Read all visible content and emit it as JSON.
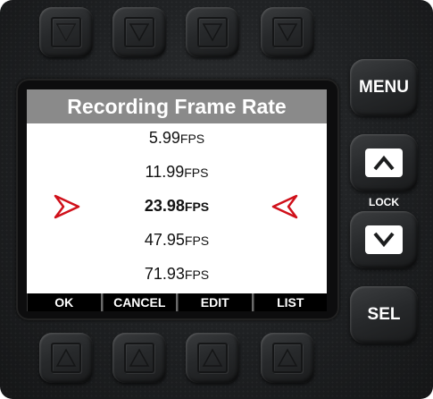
{
  "screen": {
    "title": "Recording Frame Rate",
    "fps_options": [
      {
        "value": "5.99",
        "unit": "FPS",
        "selected": false
      },
      {
        "value": "11.99",
        "unit": "FPS",
        "selected": false
      },
      {
        "value": "23.98",
        "unit": "FPS",
        "selected": true
      },
      {
        "value": "47.95",
        "unit": "FPS",
        "selected": false
      },
      {
        "value": "71.93",
        "unit": "FPS",
        "selected": false
      }
    ],
    "softkeys": [
      "OK",
      "CANCEL",
      "EDIT",
      "LIST"
    ]
  },
  "side_buttons": {
    "menu": "MENU",
    "lock": "LOCK",
    "sel": "SEL"
  },
  "colors": {
    "selection_arrow": "#d0101a",
    "title_bar": "#8a8a8a",
    "softkey_bar": "#000000"
  },
  "icons": {
    "top_keys": "down-triangle-icon",
    "bottom_keys": "up-triangle-icon",
    "up_button": "up-arrow-icon",
    "down_button": "down-arrow-icon",
    "selection_markers": "selection-arrow-icon"
  }
}
